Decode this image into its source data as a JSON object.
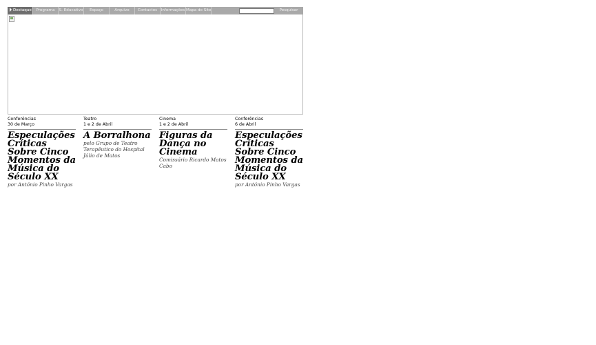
{
  "nav": {
    "items": [
      {
        "label": "Destaque",
        "active": true
      },
      {
        "label": "Programa"
      },
      {
        "label": "S. Educativo"
      },
      {
        "label": "Espaço"
      },
      {
        "label": "Arquivo"
      },
      {
        "label": "Contactos"
      },
      {
        "label": "Informações"
      },
      {
        "label": "Mapa do Site"
      }
    ],
    "search_value": "",
    "search_button": "Pesquisar"
  },
  "events": [
    {
      "category": "Conferências",
      "date": "30 de Março",
      "title": "Especulações Críticas Sobre Cinco Momentos da Música do Século XX",
      "subtitle": "por António Pinho Vargas"
    },
    {
      "category": "Teatro",
      "date": "1 e 2 de Abril",
      "title": "A Borralhona",
      "subtitle": "pelo Grupo de Teatro Terapêutico do Hospital Júlio de Matos"
    },
    {
      "category": "Cinema",
      "date": "1 e 2 de Abril",
      "title": "Figuras da Dança no Cinema",
      "subtitle": "Comissário Ricardo Matos Cabo"
    },
    {
      "category": "Conferências",
      "date": "6 de Abril",
      "title": "Especulações Críticas Sobre Cinco Momentos da Música do Século XX",
      "subtitle": "por António Pinho Vargas"
    }
  ],
  "colors": {
    "nav_bg": "#a9a9a9",
    "nav_active": "#6e6e6e"
  }
}
